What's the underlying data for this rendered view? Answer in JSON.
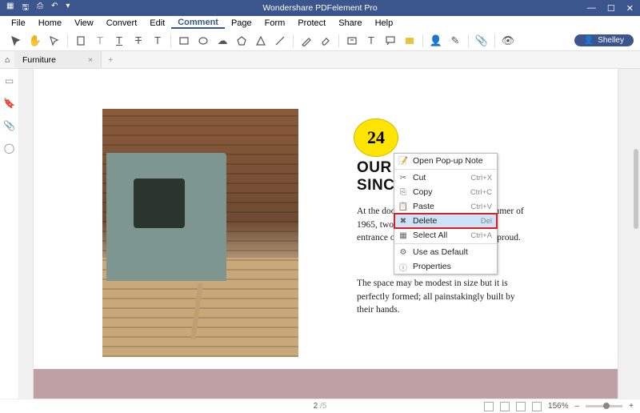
{
  "titlebar": {
    "app_name": "Wondershare PDFelement Pro"
  },
  "window_controls": {
    "min": "—",
    "max": "☐",
    "close": "✕"
  },
  "qat": {
    "logo": "▦",
    "save": "🖫",
    "print": "⎙",
    "undo": "↶",
    "redo": "▾"
  },
  "menu": [
    "File",
    "Home",
    "View",
    "Convert",
    "Edit",
    "Comment",
    "Page",
    "Form",
    "Protect",
    "Share",
    "Help"
  ],
  "menu_active_index": 5,
  "user_pill": {
    "icon": "👤",
    "name": "Shelley"
  },
  "tab": {
    "name": "Furniture",
    "close": "×",
    "add": "+",
    "home": "⌂"
  },
  "side_icons": [
    "▭",
    "◻",
    "🔖",
    "📎",
    "◯"
  ],
  "annotation_number": "24",
  "heading_line_a": "OUR",
  "heading_line_b": "SINC",
  "para1": "At the door of a quaint Vancouver summer of 1965, two cabinetmakers stand at the entrance of their new factory. They're proud.",
  "para2": "The space may be modest in size but it is perfectly formed; all painstakingly built by their hands.",
  "context_menu": [
    {
      "icon": "📝",
      "label": "Open Pop-up Note",
      "shortcut": ""
    },
    {
      "sep": true
    },
    {
      "icon": "✂",
      "label": "Cut",
      "shortcut": "Ctrl+X"
    },
    {
      "icon": "⎘",
      "label": "Copy",
      "shortcut": "Ctrl+C"
    },
    {
      "icon": "📋",
      "label": "Paste",
      "shortcut": "Ctrl+V"
    },
    {
      "icon": "✖",
      "label": "Delete",
      "shortcut": "Del",
      "highlight": true,
      "delete": true
    },
    {
      "icon": "▦",
      "label": "Select All",
      "shortcut": "Ctrl+A"
    },
    {
      "sep": true
    },
    {
      "icon": "⚙",
      "label": "Use as Default",
      "shortcut": ""
    },
    {
      "icon": "ⓘ",
      "label": "Properties",
      "shortcut": ""
    }
  ],
  "status": {
    "page_current": "2",
    "page_sep": "/",
    "page_total": "5",
    "zoom": "156%",
    "minus": "–",
    "plus": "+"
  }
}
